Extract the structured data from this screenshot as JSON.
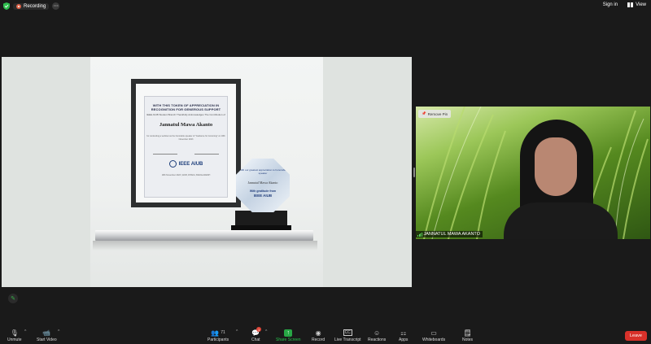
{
  "topbar": {
    "recording_label": "Recording",
    "sign_in": "Sign in",
    "view": "View"
  },
  "shared_content": {
    "certificate": {
      "heading": "WITH THIS TOKEN OF APPRECIATION IN RECOGNITION FOR GENEROUS SUPPORT",
      "subheading": "IEEE AIUB Student Branch Thankfully Acknowledges The Contribution of",
      "name": "Jannatul Mawa Akanto",
      "body": "for conducting a webinar as the honorable speaker of \"Guidance for Grooming\" on 18th November 2023",
      "logo": "IEEE AIUB",
      "footer": "18th November 2023 | AIUB, DHAKA, BANGLADESH"
    },
    "trophy": {
      "top_text": "With our greatest appreciation to honorable speaker",
      "name": "Jannatul Mawa Akanto",
      "gratitude": "With gratitude from",
      "logo": "IEEE AIUB"
    }
  },
  "video_tile": {
    "remove_pin": "Remove Pin",
    "participant_name": "JANNATUL MAWA AKANTO"
  },
  "toolbar": {
    "unmute": "Unmute",
    "start_video": "Start Video",
    "participants": "Participants",
    "participant_count": "71",
    "chat": "Chat",
    "chat_badge": "1",
    "share_screen": "Share Screen",
    "record": "Record",
    "live_transcript": "Live Transcript",
    "reactions": "Reactions",
    "apps": "Apps",
    "whiteboards": "Whiteboards",
    "notes": "Notes",
    "leave": "Leave"
  },
  "colors": {
    "background": "#1a1a1a",
    "share_accent": "#27a745",
    "leave": "#d8312a",
    "recording": "#e0644a"
  }
}
